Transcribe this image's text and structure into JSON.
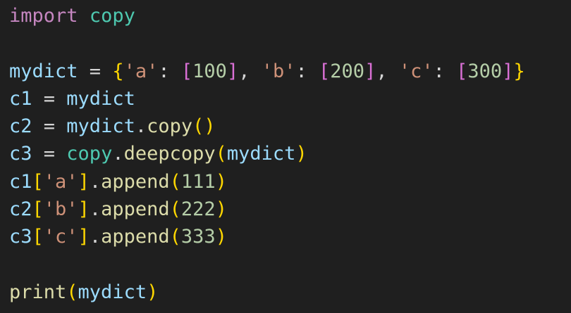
{
  "colors": {
    "background": "#1f1f1f",
    "keyword": "#c586c0",
    "module": "#4ec9b0",
    "variable": "#9cdcfe",
    "function": "#dcdcaa",
    "string": "#ce9178",
    "number": "#b5cea8",
    "bracket_gold": "#ffd700",
    "bracket_purple": "#da70d6",
    "bracket_blue": "#179fff",
    "operator": "#d4d4d4"
  },
  "code_lines": [
    [
      {
        "text": "import",
        "color": "keyword"
      },
      {
        "text": " ",
        "color": "operator"
      },
      {
        "text": "copy",
        "color": "module"
      }
    ],
    [],
    [
      {
        "text": "mydict",
        "color": "variable"
      },
      {
        "text": " = ",
        "color": "operator"
      },
      {
        "text": "{",
        "color": "bracket_gold"
      },
      {
        "text": "'a'",
        "color": "string"
      },
      {
        "text": ": ",
        "color": "operator"
      },
      {
        "text": "[",
        "color": "bracket_purple"
      },
      {
        "text": "100",
        "color": "number"
      },
      {
        "text": "]",
        "color": "bracket_purple"
      },
      {
        "text": ", ",
        "color": "operator"
      },
      {
        "text": "'b'",
        "color": "string"
      },
      {
        "text": ": ",
        "color": "operator"
      },
      {
        "text": "[",
        "color": "bracket_purple"
      },
      {
        "text": "200",
        "color": "number"
      },
      {
        "text": "]",
        "color": "bracket_purple"
      },
      {
        "text": ", ",
        "color": "operator"
      },
      {
        "text": "'c'",
        "color": "string"
      },
      {
        "text": ": ",
        "color": "operator"
      },
      {
        "text": "[",
        "color": "bracket_purple"
      },
      {
        "text": "300",
        "color": "number"
      },
      {
        "text": "]",
        "color": "bracket_purple"
      },
      {
        "text": "}",
        "color": "bracket_gold"
      }
    ],
    [
      {
        "text": "c1",
        "color": "variable"
      },
      {
        "text": " = ",
        "color": "operator"
      },
      {
        "text": "mydict",
        "color": "variable"
      }
    ],
    [
      {
        "text": "c2",
        "color": "variable"
      },
      {
        "text": " = ",
        "color": "operator"
      },
      {
        "text": "mydict",
        "color": "variable"
      },
      {
        "text": ".",
        "color": "operator"
      },
      {
        "text": "copy",
        "color": "function"
      },
      {
        "text": "()",
        "color": "bracket_gold"
      }
    ],
    [
      {
        "text": "c3",
        "color": "variable"
      },
      {
        "text": " = ",
        "color": "operator"
      },
      {
        "text": "copy",
        "color": "module"
      },
      {
        "text": ".",
        "color": "operator"
      },
      {
        "text": "deepcopy",
        "color": "function"
      },
      {
        "text": "(",
        "color": "bracket_gold"
      },
      {
        "text": "mydict",
        "color": "variable"
      },
      {
        "text": ")",
        "color": "bracket_gold"
      }
    ],
    [
      {
        "text": "c1",
        "color": "variable"
      },
      {
        "text": "[",
        "color": "bracket_gold"
      },
      {
        "text": "'a'",
        "color": "string"
      },
      {
        "text": "]",
        "color": "bracket_gold"
      },
      {
        "text": ".",
        "color": "operator"
      },
      {
        "text": "append",
        "color": "function"
      },
      {
        "text": "(",
        "color": "bracket_gold"
      },
      {
        "text": "111",
        "color": "number"
      },
      {
        "text": ")",
        "color": "bracket_gold"
      }
    ],
    [
      {
        "text": "c2",
        "color": "variable"
      },
      {
        "text": "[",
        "color": "bracket_gold"
      },
      {
        "text": "'b'",
        "color": "string"
      },
      {
        "text": "]",
        "color": "bracket_gold"
      },
      {
        "text": ".",
        "color": "operator"
      },
      {
        "text": "append",
        "color": "function"
      },
      {
        "text": "(",
        "color": "bracket_gold"
      },
      {
        "text": "222",
        "color": "number"
      },
      {
        "text": ")",
        "color": "bracket_gold"
      }
    ],
    [
      {
        "text": "c3",
        "color": "variable"
      },
      {
        "text": "[",
        "color": "bracket_gold"
      },
      {
        "text": "'c'",
        "color": "string"
      },
      {
        "text": "]",
        "color": "bracket_gold"
      },
      {
        "text": ".",
        "color": "operator"
      },
      {
        "text": "append",
        "color": "function"
      },
      {
        "text": "(",
        "color": "bracket_gold"
      },
      {
        "text": "333",
        "color": "number"
      },
      {
        "text": ")",
        "color": "bracket_gold"
      }
    ],
    [],
    [
      {
        "text": "print",
        "color": "function"
      },
      {
        "text": "(",
        "color": "bracket_gold"
      },
      {
        "text": "mydict",
        "color": "variable"
      },
      {
        "text": ")",
        "color": "bracket_gold"
      }
    ]
  ]
}
